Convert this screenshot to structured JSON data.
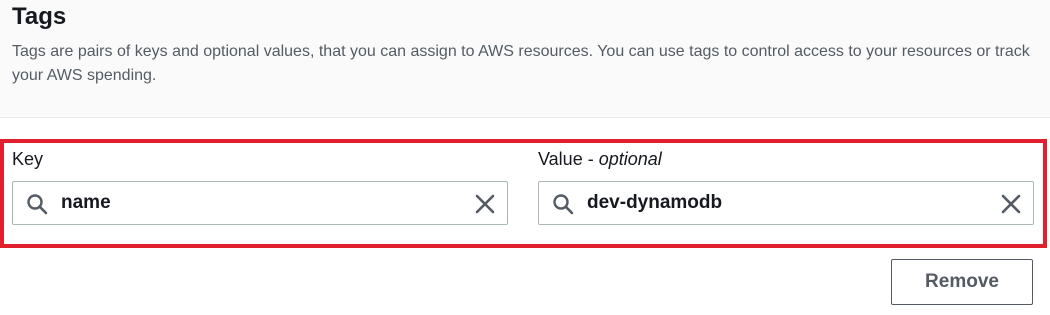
{
  "section": {
    "title": "Tags",
    "description": "Tags are pairs of keys and optional values, that you can assign to AWS resources. You can use tags to control access to your resources or track your AWS spending."
  },
  "key_field": {
    "label": "Key",
    "value": "name",
    "icon": "search-icon",
    "clear_icon": "close-icon"
  },
  "value_field": {
    "label": "Value - ",
    "label_optional": "optional",
    "value": "dev-dynamodb",
    "icon": "search-icon",
    "clear_icon": "close-icon"
  },
  "actions": {
    "remove_label": "Remove"
  },
  "colors": {
    "highlight": "#e0202e",
    "text": "#16191f",
    "muted": "#545b64",
    "border": "#aab7b8"
  }
}
